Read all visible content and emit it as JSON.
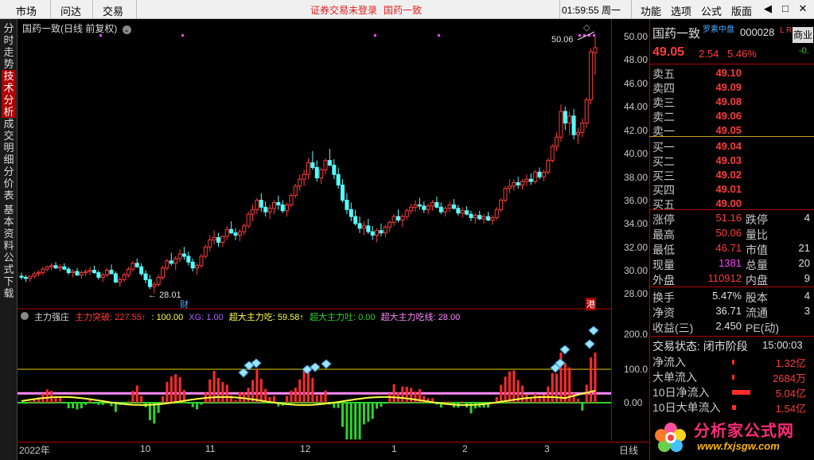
{
  "topbar": {
    "menu": [
      "市场",
      "问达",
      "交易"
    ],
    "status_left": "证券交易未登录",
    "status_right": "国药一致",
    "clock": "01:59:55 周一",
    "right_menu": [
      "功能",
      "选项",
      "公式",
      "版面"
    ],
    "win_buttons": [
      "◀",
      "□",
      "✕"
    ]
  },
  "left_tabs": [
    {
      "label": "分时走势",
      "active": false
    },
    {
      "label": "技术分析",
      "active": true
    },
    {
      "label": "成交明细",
      "active": false
    },
    {
      "label": "分价表",
      "active": false
    },
    {
      "label": "基本资料",
      "active": false
    },
    {
      "label": "公式下载",
      "active": false
    }
  ],
  "chart": {
    "title": "国药一致(日线 前复权)",
    "high_label": "50.06",
    "low_label": "28.01",
    "event_markers": [
      "财",
      "港"
    ],
    "y_ticks": [
      "50.00",
      "48.00",
      "46.00",
      "44.00",
      "42.00",
      "40.00",
      "38.00",
      "36.00",
      "34.00",
      "32.00",
      "30.00",
      "28.00"
    ],
    "ind_y_ticks": [
      "200.0",
      "100.0",
      "0.00"
    ],
    "x_ticks": [
      "2022年",
      "10",
      "11",
      "12",
      "1",
      "2",
      "3"
    ],
    "bottom_right_label": "日线"
  },
  "indicator": {
    "name": "主力强庄",
    "items": [
      {
        "label": "主力突破: 227.55↑",
        "color": "#ff3b3b"
      },
      {
        "label": ": 100.00",
        "color": "#ffff40"
      },
      {
        "label": "XG: 1.00",
        "color": "#b060ff"
      },
      {
        "label": "超大主力吃: 59.58↑",
        "color": "#ffff40"
      },
      {
        "label": "超大主力吐: 0.00",
        "color": "#2bd52b"
      },
      {
        "label": "超大主力吃线: 28.00",
        "color": "#ff88ff"
      }
    ]
  },
  "quote": {
    "name": "国药一致",
    "tag": "罗素中盘",
    "code": "000028",
    "flags": "L R",
    "sector": "商业",
    "sector_change": "-0.",
    "price": "49.05",
    "change": "2.54",
    "change_pct": "5.46%",
    "asks": [
      {
        "label": "卖五",
        "price": "49.10"
      },
      {
        "label": "卖四",
        "price": "49.09"
      },
      {
        "label": "卖三",
        "price": "49.08"
      },
      {
        "label": "卖二",
        "price": "49.06"
      },
      {
        "label": "卖一",
        "price": "49.05"
      }
    ],
    "bids": [
      {
        "label": "买一",
        "price": "49.04"
      },
      {
        "label": "买二",
        "price": "49.03"
      },
      {
        "label": "买三",
        "price": "49.02"
      },
      {
        "label": "买四",
        "price": "49.01"
      },
      {
        "label": "买五",
        "price": "49.00"
      }
    ],
    "stats": [
      {
        "l1": "涨停",
        "v1": "51.16",
        "c1": "red",
        "l2": "跌停",
        "v2": "4"
      },
      {
        "l1": "最高",
        "v1": "50.06",
        "c1": "red",
        "l2": "量比",
        "v2": ""
      },
      {
        "l1": "最低",
        "v1": "46.71",
        "c1": "red",
        "l2": "市值",
        "v2": "21"
      },
      {
        "l1": "现量",
        "v1": "1381",
        "c1": "magenta",
        "l2": "总量",
        "v2": "20"
      },
      {
        "l1": "外盘",
        "v1": "110912",
        "c1": "red",
        "l2": "内盘",
        "v2": "9"
      }
    ],
    "fin": [
      {
        "l1": "换手",
        "v1": "5.47%",
        "l2": "股本",
        "v2": "4"
      },
      {
        "l1": "净资",
        "v1": "36.71",
        "l2": "流通",
        "v2": "3"
      },
      {
        "l1": "收益(三)",
        "v1": "2.450",
        "l2": "PE(动)",
        "v2": ""
      }
    ],
    "trade_state_label": "交易状态: 闭市阶段",
    "trade_state_time": "15:00:03",
    "flows": [
      {
        "label": "净流入",
        "value": "1.32亿",
        "bar": 0.05
      },
      {
        "label": "大单流入",
        "value": "2684万",
        "bar": 0.02
      },
      {
        "label": "10日净流入",
        "value": "5.04亿",
        "bar": 0.9
      },
      {
        "label": "10日大单流入",
        "value": "1.54亿",
        "bar": 0.2
      }
    ],
    "logo_text": "分析家公式网",
    "logo_url": "www.fxjsgw.com"
  },
  "chart_data": {
    "type": "candlestick",
    "ylim": [
      27,
      51.5
    ],
    "candles": [
      [
        29.5,
        29.8,
        29.2,
        29.4
      ],
      [
        29.4,
        29.6,
        29.0,
        29.3
      ],
      [
        29.3,
        29.5,
        29.0,
        29.5
      ],
      [
        29.5,
        29.9,
        29.3,
        29.7
      ],
      [
        29.7,
        30.0,
        29.5,
        29.8
      ],
      [
        29.8,
        30.3,
        29.6,
        30.1
      ],
      [
        30.1,
        30.4,
        29.9,
        30.3
      ],
      [
        30.3,
        30.6,
        30.0,
        30.4
      ],
      [
        30.4,
        30.7,
        30.1,
        30.2
      ],
      [
        30.2,
        30.5,
        29.9,
        30.3
      ],
      [
        30.3,
        30.6,
        30.0,
        30.1
      ],
      [
        30.1,
        30.3,
        29.6,
        29.8
      ],
      [
        29.8,
        30.1,
        29.4,
        29.9
      ],
      [
        29.9,
        30.2,
        29.5,
        29.6
      ],
      [
        29.6,
        30.0,
        29.3,
        29.8
      ],
      [
        29.8,
        30.1,
        29.5,
        29.9
      ],
      [
        29.9,
        30.3,
        29.6,
        30.0
      ],
      [
        30.0,
        30.4,
        29.7,
        29.8
      ],
      [
        29.8,
        30.0,
        29.2,
        29.4
      ],
      [
        29.4,
        29.8,
        29.0,
        29.6
      ],
      [
        29.6,
        30.2,
        29.4,
        30.0
      ],
      [
        30.0,
        30.5,
        29.8,
        29.7
      ],
      [
        29.7,
        29.9,
        28.9,
        29.0
      ],
      [
        29.0,
        29.4,
        28.6,
        29.2
      ],
      [
        29.2,
        29.8,
        29.0,
        29.6
      ],
      [
        29.6,
        30.3,
        29.4,
        30.1
      ],
      [
        30.1,
        30.8,
        29.9,
        30.6
      ],
      [
        30.6,
        31.0,
        30.2,
        30.3
      ],
      [
        30.3,
        30.6,
        29.5,
        29.7
      ],
      [
        29.7,
        30.0,
        28.9,
        29.2
      ],
      [
        29.2,
        29.6,
        28.4,
        28.6
      ],
      [
        28.6,
        29.0,
        28.01,
        28.8
      ],
      [
        28.8,
        29.6,
        28.6,
        29.4
      ],
      [
        29.4,
        30.4,
        29.2,
        30.2
      ],
      [
        30.2,
        31.0,
        30.0,
        30.8
      ],
      [
        30.8,
        31.5,
        30.4,
        30.6
      ],
      [
        30.6,
        31.2,
        30.0,
        31.0
      ],
      [
        31.0,
        31.8,
        30.7,
        31.4
      ],
      [
        31.4,
        32.0,
        30.9,
        31.2
      ],
      [
        31.2,
        31.6,
        30.4,
        30.7
      ],
      [
        30.7,
        31.0,
        29.9,
        30.2
      ],
      [
        30.2,
        30.6,
        29.6,
        30.4
      ],
      [
        30.4,
        31.4,
        30.2,
        31.2
      ],
      [
        31.2,
        32.2,
        31.0,
        32.0
      ],
      [
        32.0,
        33.0,
        31.6,
        32.6
      ],
      [
        32.6,
        33.4,
        32.2,
        32.8
      ],
      [
        32.8,
        33.2,
        32.0,
        32.4
      ],
      [
        32.4,
        33.0,
        32.0,
        32.9
      ],
      [
        32.9,
        33.8,
        32.6,
        33.5
      ],
      [
        33.5,
        34.2,
        33.1,
        33.2
      ],
      [
        33.2,
        33.6,
        32.6,
        33.0
      ],
      [
        33.0,
        33.5,
        32.5,
        33.3
      ],
      [
        33.3,
        34.0,
        33.0,
        33.8
      ],
      [
        33.8,
        35.0,
        33.6,
        34.8
      ],
      [
        34.8,
        35.6,
        34.2,
        35.2
      ],
      [
        35.2,
        36.2,
        34.8,
        36.0
      ],
      [
        36.0,
        36.6,
        35.0,
        35.4
      ],
      [
        35.4,
        35.9,
        34.6,
        35.0
      ],
      [
        35.0,
        35.6,
        34.4,
        35.3
      ],
      [
        35.3,
        36.0,
        34.8,
        35.8
      ],
      [
        35.8,
        36.4,
        35.2,
        35.6
      ],
      [
        35.6,
        36.0,
        34.9,
        35.1
      ],
      [
        35.1,
        35.8,
        34.6,
        35.6
      ],
      [
        35.6,
        36.6,
        35.4,
        36.4
      ],
      [
        36.4,
        37.4,
        36.2,
        37.2
      ],
      [
        37.2,
        38.2,
        36.8,
        37.8
      ],
      [
        37.8,
        38.6,
        37.2,
        38.2
      ],
      [
        38.2,
        39.6,
        37.8,
        39.2
      ],
      [
        39.2,
        40.2,
        38.6,
        38.8
      ],
      [
        38.8,
        39.4,
        37.6,
        37.9
      ],
      [
        37.9,
        38.8,
        37.4,
        38.6
      ],
      [
        38.6,
        39.6,
        38.2,
        39.4
      ],
      [
        39.4,
        40.4,
        38.9,
        39.0
      ],
      [
        39.0,
        39.5,
        37.8,
        38.2
      ],
      [
        38.2,
        38.8,
        37.0,
        37.3
      ],
      [
        37.3,
        37.8,
        35.8,
        36.0
      ],
      [
        36.0,
        36.6,
        34.8,
        35.2
      ],
      [
        35.2,
        35.8,
        34.2,
        34.6
      ],
      [
        34.6,
        35.2,
        33.8,
        34.0
      ],
      [
        34.0,
        34.6,
        33.2,
        33.6
      ],
      [
        33.6,
        34.2,
        33.0,
        33.8
      ],
      [
        33.8,
        34.4,
        33.1,
        33.3
      ],
      [
        33.3,
        33.8,
        32.6,
        33.0
      ],
      [
        33.0,
        33.6,
        32.4,
        33.4
      ],
      [
        33.4,
        34.0,
        32.9,
        33.2
      ],
      [
        33.2,
        33.9,
        32.8,
        33.7
      ],
      [
        33.7,
        34.3,
        33.3,
        34.1
      ],
      [
        34.1,
        34.8,
        33.8,
        34.6
      ],
      [
        34.6,
        35.2,
        34.1,
        34.3
      ],
      [
        34.3,
        34.8,
        33.7,
        34.6
      ],
      [
        34.6,
        35.3,
        34.3,
        35.1
      ],
      [
        35.1,
        35.7,
        34.8,
        35.4
      ],
      [
        35.4,
        36.0,
        35.0,
        35.6
      ],
      [
        35.6,
        36.2,
        35.2,
        35.5
      ],
      [
        35.5,
        35.9,
        34.9,
        35.2
      ],
      [
        35.2,
        35.7,
        34.8,
        35.5
      ],
      [
        35.5,
        36.0,
        35.1,
        35.8
      ],
      [
        35.8,
        36.3,
        35.3,
        35.4
      ],
      [
        35.4,
        35.8,
        34.8,
        35.0
      ],
      [
        35.0,
        35.5,
        34.6,
        35.3
      ],
      [
        35.3,
        35.9,
        35.0,
        35.6
      ],
      [
        35.6,
        36.1,
        35.2,
        35.3
      ],
      [
        35.3,
        35.6,
        34.7,
        34.9
      ],
      [
        34.9,
        35.4,
        34.5,
        35.1
      ],
      [
        35.1,
        35.5,
        34.7,
        34.8
      ],
      [
        34.8,
        35.1,
        34.2,
        34.5
      ],
      [
        34.5,
        34.9,
        34.0,
        34.7
      ],
      [
        34.7,
        35.1,
        34.3,
        34.4
      ],
      [
        34.4,
        34.8,
        34.0,
        34.6
      ],
      [
        34.6,
        35.0,
        34.2,
        34.3
      ],
      [
        34.3,
        34.7,
        33.9,
        34.5
      ],
      [
        34.5,
        35.4,
        34.3,
        35.2
      ],
      [
        35.2,
        36.2,
        35.0,
        36.0
      ],
      [
        36.0,
        37.2,
        35.8,
        37.0
      ],
      [
        37.0,
        37.8,
        36.6,
        37.2
      ],
      [
        37.2,
        37.8,
        36.8,
        37.5
      ],
      [
        37.5,
        38.0,
        37.0,
        37.3
      ],
      [
        37.3,
        37.8,
        36.9,
        37.6
      ],
      [
        37.6,
        38.2,
        37.2,
        37.8
      ],
      [
        37.8,
        38.3,
        37.3,
        37.6
      ],
      [
        37.6,
        38.6,
        37.4,
        38.4
      ],
      [
        38.4,
        38.8,
        37.8,
        38.0
      ],
      [
        38.0,
        38.6,
        37.6,
        38.4
      ],
      [
        38.4,
        39.6,
        38.2,
        39.4
      ],
      [
        39.4,
        40.8,
        39.2,
        40.6
      ],
      [
        40.6,
        41.8,
        40.2,
        41.4
      ],
      [
        41.4,
        44.2,
        41.0,
        43.6
      ],
      [
        43.6,
        44.0,
        42.0,
        42.6
      ],
      [
        42.6,
        43.6,
        41.6,
        43.2
      ],
      [
        43.2,
        43.8,
        41.2,
        41.6
      ],
      [
        41.6,
        42.2,
        40.8,
        41.8
      ],
      [
        41.8,
        43.0,
        41.4,
        42.6
      ],
      [
        42.6,
        44.8,
        42.2,
        44.6
      ],
      [
        44.6,
        49.0,
        44.2,
        48.7
      ],
      [
        48.6,
        50.06,
        46.71,
        49.05
      ]
    ],
    "indicator": {
      "level_line": 100,
      "ylim": [
        -110,
        250
      ],
      "pink_line": 28
    }
  }
}
